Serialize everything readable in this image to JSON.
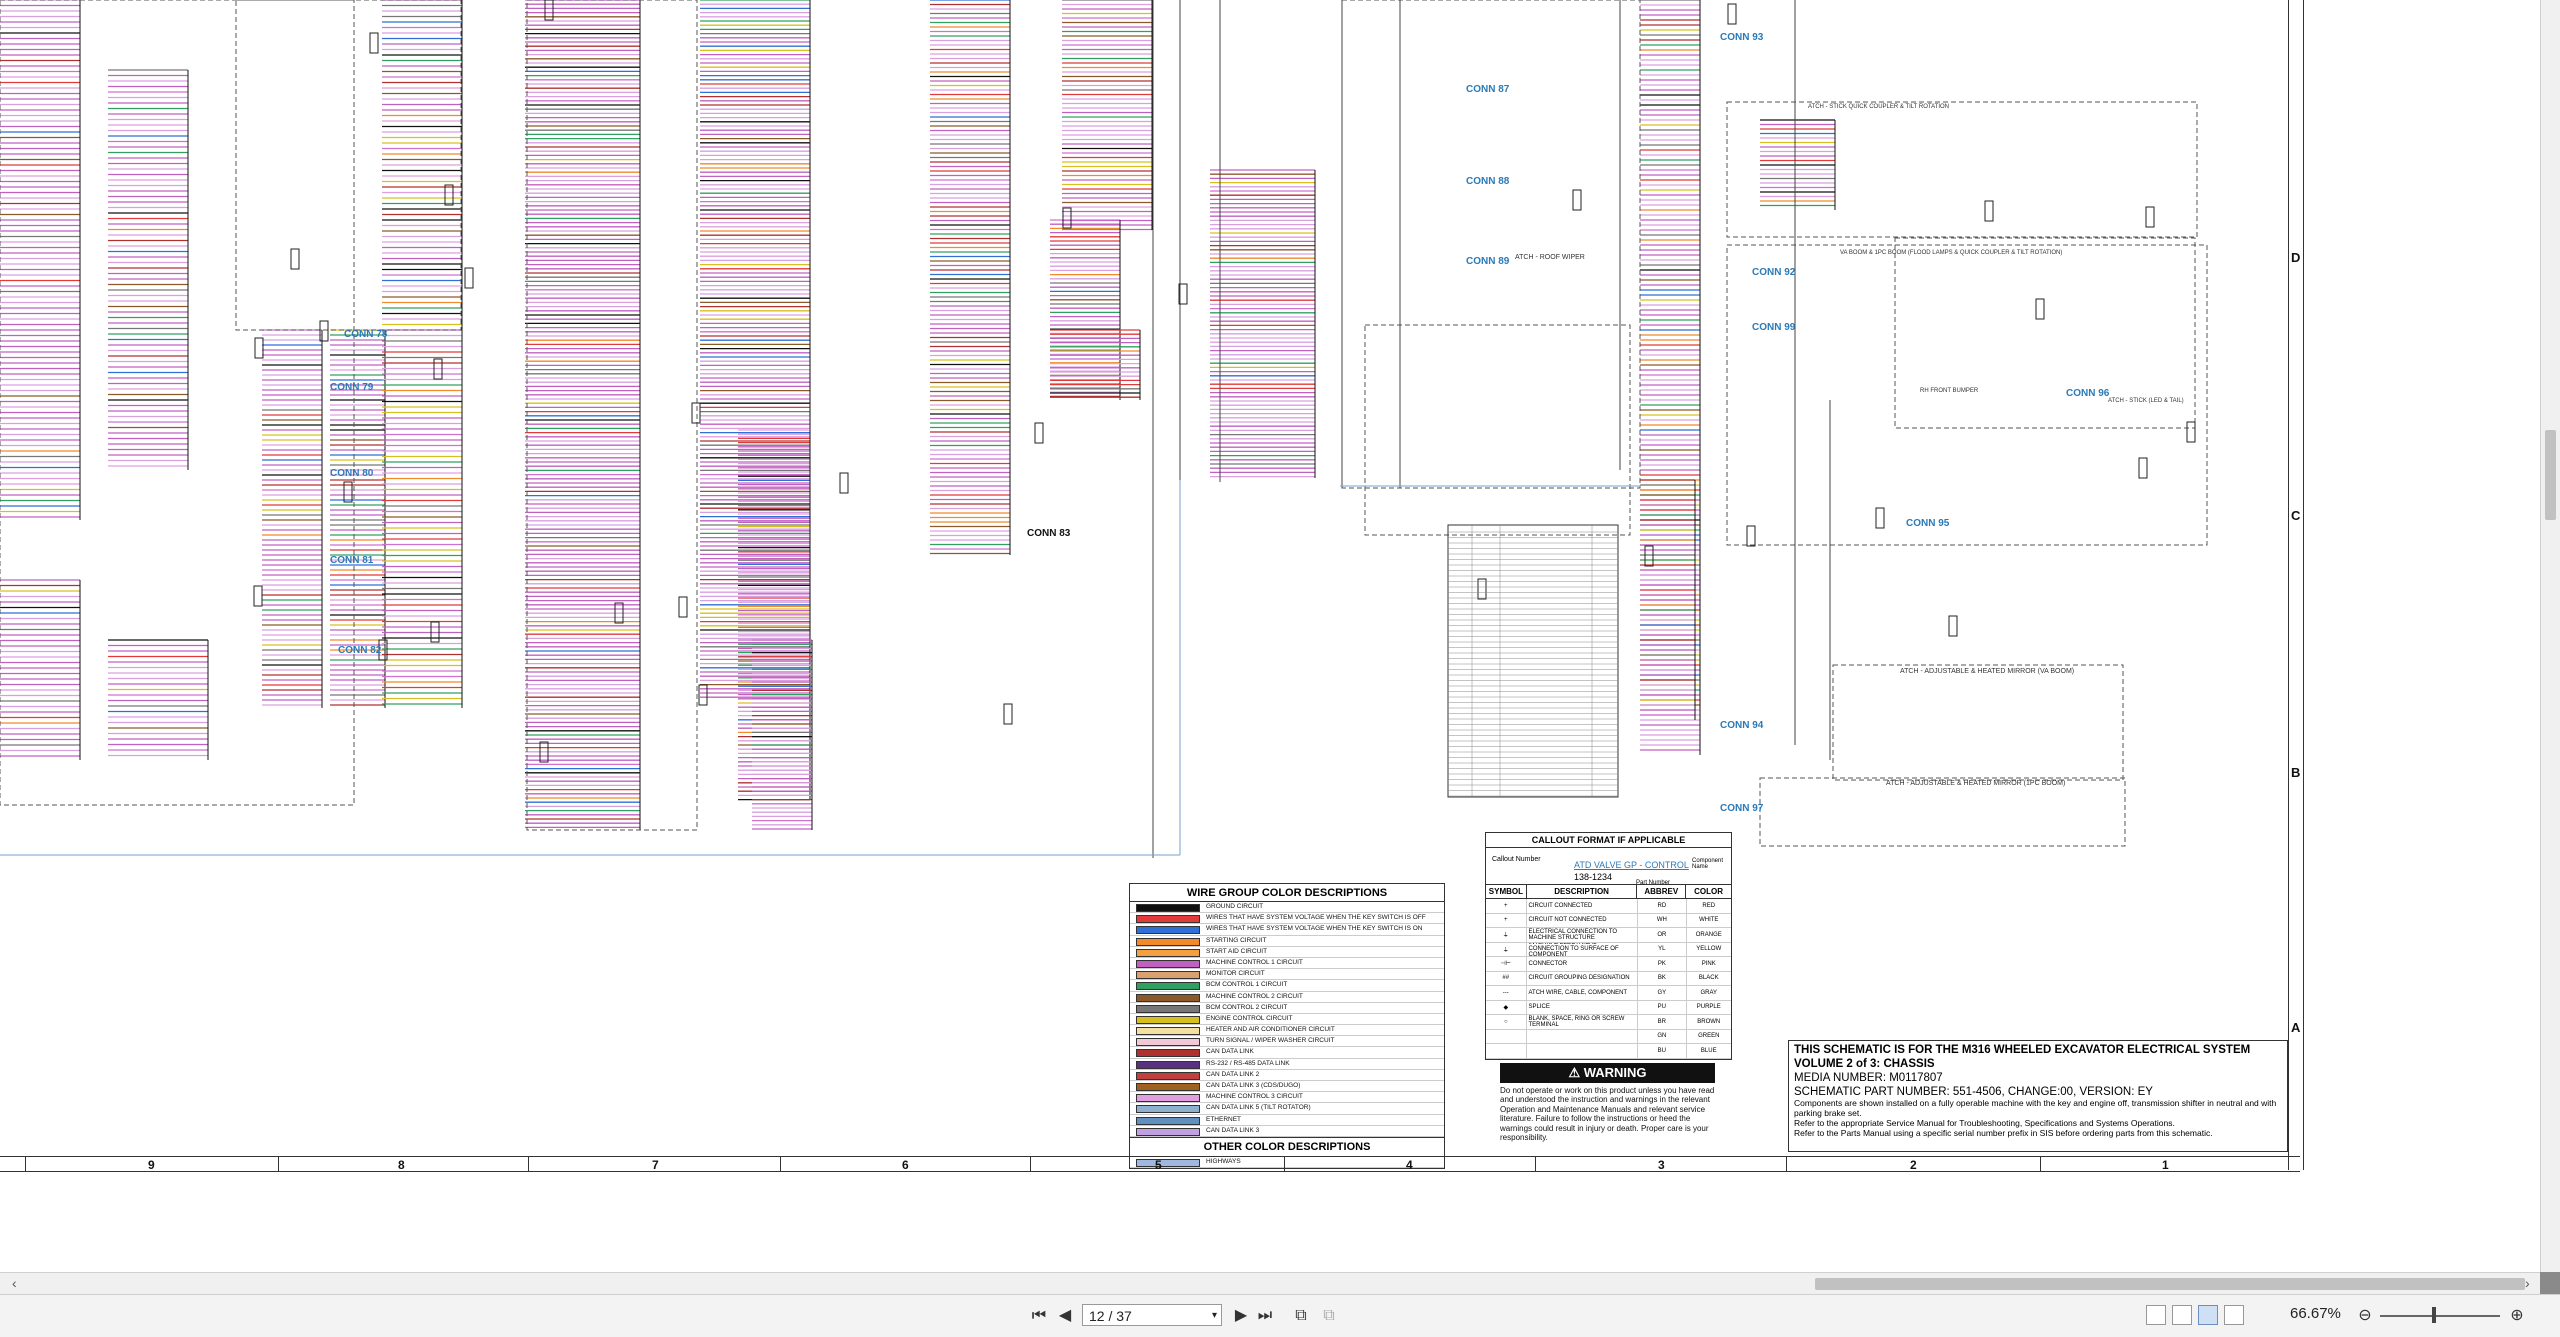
{
  "schematic": {
    "connectors": [
      "CONN 78",
      "CONN 79",
      "CONN 80",
      "CONN 81",
      "CONN 82",
      "CONN 83",
      "CONN 87",
      "CONN 88",
      "CONN 89",
      "CONN 92",
      "CONN 93",
      "CONN 94",
      "CONN 95",
      "CONN 96",
      "CONN 97",
      "CONN 99"
    ],
    "section_labels": {
      "roof_wiper": "ATCH - ROOF WIPER",
      "quick_coupler": "ATCH - STICK QUICK COUPLER & TILT ROTATION",
      "boom_flood": "VA BOOM & 1PC BOOM (FLOOD LAMPS & QUICK COUPLER & TILT ROTATION)",
      "stick_lamp": "ATCH - STICK (LED & TAIL)",
      "front_bumper": "RH FRONT BUMPER",
      "mirror_vaboom": "ATCH - ADJUSTABLE & HEATED MIRROR (VA BOOM)",
      "mirror_1pc": "ATCH - ADJUSTABLE & HEATED MIRROR (1PC BOOM)"
    }
  },
  "wire_legend": {
    "title": "WIRE GROUP COLOR DESCRIPTIONS",
    "rows": [
      {
        "label": "GROUND CIRCUIT",
        "color": "#111111"
      },
      {
        "label": "WIRES THAT HAVE SYSTEM VOLTAGE WHEN THE KEY SWITCH IS OFF",
        "color": "#e23a3a"
      },
      {
        "label": "WIRES THAT HAVE SYSTEM VOLTAGE WHEN THE KEY SWITCH IS ON",
        "color": "#2f6fd6"
      },
      {
        "label": "STARTING CIRCUIT",
        "color": "#f08a2a"
      },
      {
        "label": "START AID CIRCUIT",
        "color": "#f5a040"
      },
      {
        "label": "MACHINE CONTROL 1 CIRCUIT",
        "color": "#c060c0"
      },
      {
        "label": "MONITOR CIRCUIT",
        "color": "#d9a070"
      },
      {
        "label": "BCM CONTROL 1 CIRCUIT",
        "color": "#30a060"
      },
      {
        "label": "MACHINE CONTROL 2 CIRCUIT",
        "color": "#8b5a2b"
      },
      {
        "label": "BCM CONTROL 2 CIRCUIT",
        "color": "#777777"
      },
      {
        "label": "ENGINE CONTROL CIRCUIT",
        "color": "#d6c020"
      },
      {
        "label": "HEATER AND AIR CONDITIONER CIRCUIT",
        "color": "#f4e0a0"
      },
      {
        "label": "TURN SIGNAL / WIPER WASHER CIRCUIT",
        "color": "#f0c8d8"
      },
      {
        "label": "CAN DATA LINK",
        "color": "#b03030"
      },
      {
        "label": "RS-232 / RS-485 DATA LINK",
        "color": "#5a3080"
      },
      {
        "label": "CAN DATA LINK 2",
        "color": "#c04040"
      },
      {
        "label": "CAN DATA LINK 3 (CDS/DUGO)",
        "color": "#a06020"
      },
      {
        "label": "MACHINE CONTROL 3 CIRCUIT",
        "color": "#e0a0e0"
      },
      {
        "label": "CAN DATA LINK 5 (TILT ROTATOR)",
        "color": "#90b0d0"
      },
      {
        "label": "ETHERNET",
        "color": "#6090c0"
      },
      {
        "label": "CAN DATA LINK 3",
        "color": "#c0a0e0"
      }
    ],
    "other_title": "OTHER COLOR DESCRIPTIONS",
    "other_rows": [
      {
        "label": "HIGHWAYS",
        "color": "#9fb8e0"
      }
    ]
  },
  "callout": {
    "title": "CALLOUT FORMAT IF APPLICABLE",
    "callout_number": "Callout Number",
    "example_link": "ATD VALVE GP - CONTROL",
    "example_pn": "138-1234",
    "component_name": "Component Name",
    "part_number": "Part Number"
  },
  "symbols": {
    "headers": [
      "SYMBOL",
      "DESCRIPTION",
      "ABBREV",
      "COLOR"
    ],
    "rows": [
      {
        "sym": "+",
        "desc": "CIRCUIT CONNECTED",
        "abbr": "RD",
        "color": "RED"
      },
      {
        "sym": "+",
        "desc": "CIRCUIT NOT CONNECTED",
        "abbr": "WH",
        "color": "WHITE"
      },
      {
        "sym": "⏚",
        "desc": "ELECTRICAL CONNECTION TO MACHINE STRUCTURE",
        "abbr": "OR",
        "color": "ORANGE"
      },
      {
        "sym": "⏚",
        "desc": "INTERNAL ELECTRICAL CONNECTION TO SURFACE OF COMPONENT",
        "abbr": "YL",
        "color": "YELLOW"
      },
      {
        "sym": "⊣⊢",
        "desc": "CONNECTOR",
        "abbr": "PK",
        "color": "PINK"
      },
      {
        "sym": "##",
        "desc": "CIRCUIT GROUPING DESIGNATION",
        "abbr": "BK",
        "color": "BLACK"
      },
      {
        "sym": "---",
        "desc": "ATCH WIRE, CABLE, COMPONENT",
        "abbr": "GY",
        "color": "GRAY"
      },
      {
        "sym": "◆",
        "desc": "SPLICE",
        "abbr": "PU",
        "color": "PURPLE"
      },
      {
        "sym": "○",
        "desc": "BLANK, SPACE, RING OR SCREW TERMINAL",
        "abbr": "BR",
        "color": "BROWN"
      },
      {
        "sym": "",
        "desc": "",
        "abbr": "GN",
        "color": "GREEN"
      },
      {
        "sym": "",
        "desc": "",
        "abbr": "BU",
        "color": "BLUE"
      }
    ]
  },
  "warning": {
    "title": "WARNING",
    "text": "Do not operate or work on this product unless you have read and understood the instruction and warnings in the relevant Operation and Maintenance Manuals and relevant service literature. Failure to follow the instructions or heed the warnings could result in injury or death. Proper care is your responsibility."
  },
  "title_block": {
    "line1": "THIS SCHEMATIC IS FOR THE M316 WHEELED EXCAVATOR ELECTRICAL SYSTEM",
    "line2": "VOLUME 2 of 3: CHASSIS",
    "media": "MEDIA NUMBER: M0117807",
    "part": "SCHEMATIC PART NUMBER: 551-4506, CHANGE:00, VERSION: EY",
    "note1": "Components are shown installed on a fully operable machine with the key and engine off, transmission shifter in neutral and with parking brake set.",
    "note2": "Refer to the appropriate Service Manual for Troubleshooting, Specifications and Systems Operations.",
    "note3": "Refer to the Parts Manual using a specific serial number prefix in SIS before ordering parts from this schematic."
  },
  "ruler": {
    "columns": [
      "9",
      "8",
      "7",
      "6",
      "5",
      "4",
      "3",
      "2",
      "1"
    ],
    "rows": [
      "D",
      "C",
      "B",
      "A"
    ]
  },
  "viewer": {
    "page_value": "12 / 37",
    "zoom": "66.67%"
  }
}
